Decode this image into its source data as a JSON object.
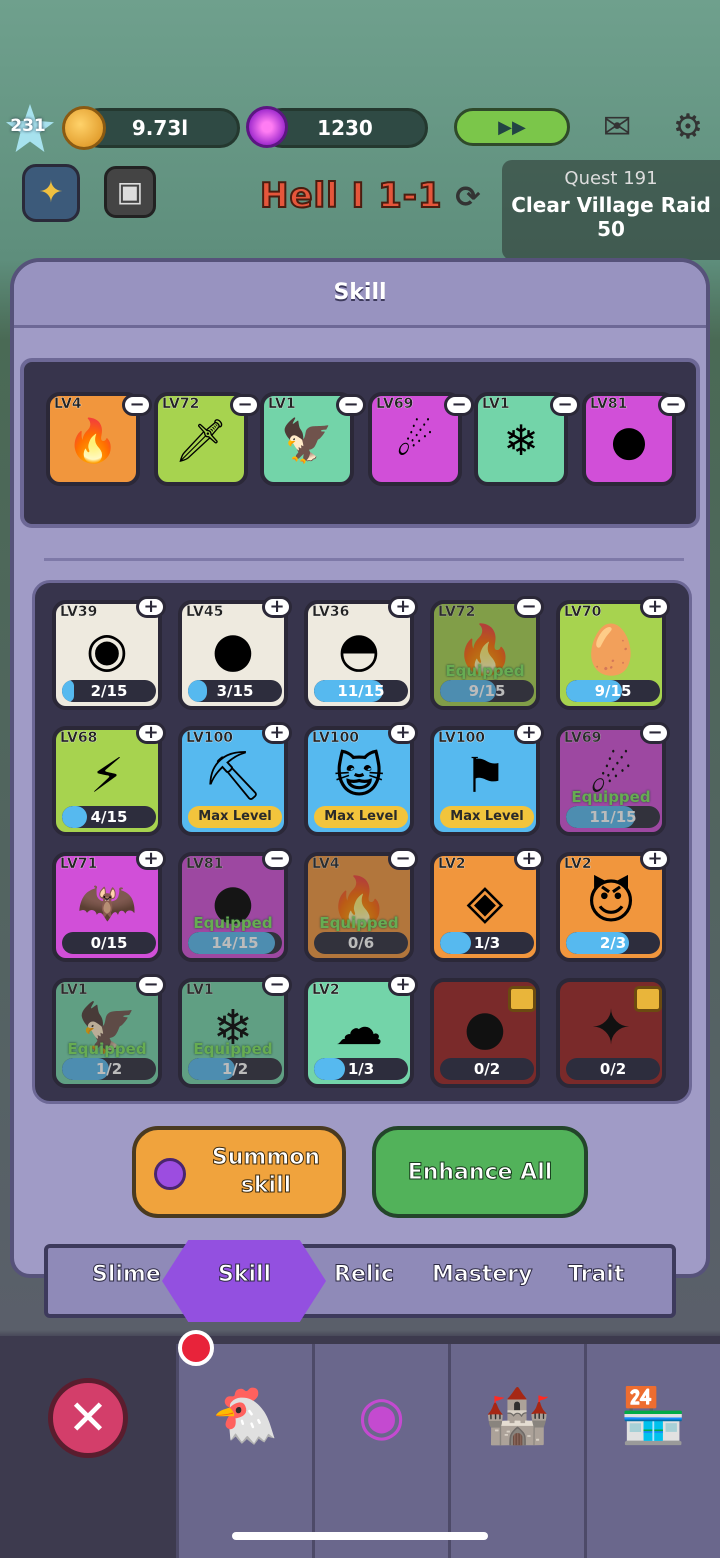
{
  "header": {
    "player_level": "231",
    "gold": "9.73l",
    "gems": "1230",
    "fast_forward_label": "▶▶",
    "mail_icon": "mail-icon",
    "settings_icon": "gear-icon",
    "stage": "Hell I 1-1"
  },
  "quest": {
    "title": "Quest 191",
    "task": "Clear Village Raid",
    "count": "50"
  },
  "panel": {
    "title": "Skill"
  },
  "equipped": [
    {
      "level": "LV4",
      "color": "#f1963d",
      "icon": "fire-icon",
      "glyph": "🔥"
    },
    {
      "level": "LV72",
      "color": "#a7d34f",
      "icon": "flame-sword-icon",
      "glyph": "🗡"
    },
    {
      "level": "LV1",
      "color": "#73d4a9",
      "icon": "bird-icon",
      "glyph": "🦅"
    },
    {
      "level": "LV69",
      "color": "#d14fd8",
      "icon": "meteor-icon",
      "glyph": "☄"
    },
    {
      "level": "LV1",
      "color": "#73d4a9",
      "icon": "snowflake-icon",
      "glyph": "❄"
    },
    {
      "level": "LV81",
      "color": "#d14fd8",
      "icon": "wind-up-slime-icon",
      "glyph": "●"
    }
  ],
  "skills": [
    {
      "level": "LV39",
      "color": "#eeeadf",
      "icon": "water-orb-icon",
      "glyph": "◉",
      "progress": "2/15",
      "fill": 0.13,
      "badge": "+",
      "equipped": false
    },
    {
      "level": "LV45",
      "color": "#eeeadf",
      "icon": "rolling-coin-icon",
      "glyph": "●",
      "progress": "3/15",
      "fill": 0.2,
      "badge": "+",
      "equipped": false
    },
    {
      "level": "LV36",
      "color": "#eeeadf",
      "icon": "slime-clone-icon",
      "glyph": "◓",
      "progress": "11/15",
      "fill": 0.73,
      "badge": "+",
      "equipped": false
    },
    {
      "level": "LV72",
      "color": "#a7d34f",
      "icon": "flame-sword-icon",
      "glyph": "🔥",
      "progress": "9/15",
      "fill": 0.6,
      "badge": "−",
      "equipped": true
    },
    {
      "level": "LV70",
      "color": "#a7d34f",
      "icon": "cracked-egg-icon",
      "glyph": "🥚",
      "progress": "9/15",
      "fill": 0.6,
      "badge": "+",
      "equipped": false
    },
    {
      "level": "LV68",
      "color": "#a7d34f",
      "icon": "lightning-icon",
      "glyph": "⚡",
      "progress": "4/15",
      "fill": 0.27,
      "badge": "+",
      "equipped": false
    },
    {
      "level": "LV100",
      "color": "#56b9ef",
      "icon": "pickaxe-icon",
      "glyph": "⛏",
      "progress": "Max Level",
      "fill": 1,
      "badge": "+",
      "equipped": false,
      "max": true
    },
    {
      "level": "LV100",
      "color": "#56b9ef",
      "icon": "cat-slime-icon",
      "glyph": "😺",
      "progress": "Max Level",
      "fill": 1,
      "badge": "+",
      "equipped": false,
      "max": true
    },
    {
      "level": "LV100",
      "color": "#56b9ef",
      "icon": "banner-icon",
      "glyph": "⚑",
      "progress": "Max Level",
      "fill": 1,
      "badge": "+",
      "equipped": false,
      "max": true
    },
    {
      "level": "LV69",
      "color": "#d14fd8",
      "icon": "meteor-icon",
      "glyph": "☄",
      "progress": "11/15",
      "fill": 0.73,
      "badge": "−",
      "equipped": true
    },
    {
      "level": "LV71",
      "color": "#d14fd8",
      "icon": "bat-icon",
      "glyph": "🦇",
      "progress": "0/15",
      "fill": 0,
      "badge": "+",
      "equipped": false
    },
    {
      "level": "LV81",
      "color": "#d14fd8",
      "icon": "wind-up-slime-icon",
      "glyph": "●",
      "progress": "14/15",
      "fill": 0.93,
      "badge": "−",
      "equipped": true
    },
    {
      "level": "LV4",
      "color": "#f1963d",
      "icon": "fire-icon",
      "glyph": "🔥",
      "progress": "0/6",
      "fill": 0,
      "badge": "−",
      "equipped": true
    },
    {
      "level": "LV2",
      "color": "#f1963d",
      "icon": "dark-eye-icon",
      "glyph": "◈",
      "progress": "1/3",
      "fill": 0.33,
      "badge": "+",
      "equipped": false
    },
    {
      "level": "LV2",
      "color": "#f1963d",
      "icon": "devil-slime-icon",
      "glyph": "😈",
      "progress": "2/3",
      "fill": 0.67,
      "badge": "+",
      "equipped": false
    },
    {
      "level": "LV1",
      "color": "#73d4a9",
      "icon": "bird-icon",
      "glyph": "🦅",
      "progress": "1/2",
      "fill": 0.5,
      "badge": "−",
      "equipped": true
    },
    {
      "level": "LV1",
      "color": "#73d4a9",
      "icon": "snowflake-icon",
      "glyph": "❄",
      "progress": "1/2",
      "fill": 0.5,
      "badge": "−",
      "equipped": true
    },
    {
      "level": "LV2",
      "color": "#73d4a9",
      "icon": "cloud-icon",
      "glyph": "☁",
      "progress": "1/3",
      "fill": 0.33,
      "badge": "+",
      "equipped": false
    },
    {
      "level": "",
      "color": "#7a2a2a",
      "icon": "black-hole-icon",
      "glyph": "●",
      "progress": "0/2",
      "fill": 0,
      "badge": "",
      "equipped": false,
      "locked": true
    },
    {
      "level": "",
      "color": "#7a2a2a",
      "icon": "shadow-beast-icon",
      "glyph": "✦",
      "progress": "0/2",
      "fill": 0,
      "badge": "",
      "equipped": false,
      "locked": true
    }
  ],
  "equipped_label": "Equipped",
  "actions": {
    "summon_line1": "Summon",
    "summon_line2": "skill",
    "enhance_all": "Enhance All"
  },
  "tabs": [
    "Slime",
    "Skill",
    "Relic",
    "Mastery",
    "Trait"
  ],
  "bottom_nav": [
    "close-icon",
    "chicken-icon",
    "portal-icon",
    "castle-icon",
    "shop-icon"
  ]
}
